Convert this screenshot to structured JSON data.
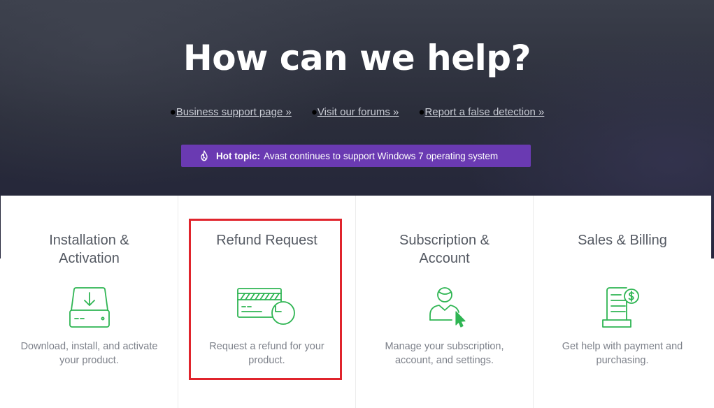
{
  "hero": {
    "title": "How can we help?",
    "links": [
      {
        "label": "Business support page »"
      },
      {
        "label": "Visit our forums »"
      },
      {
        "label": "Report a false detection »"
      }
    ],
    "hot_topic": {
      "label": "Hot topic:",
      "text": "Avast continues to support Windows 7 operating system",
      "icon": "flame-icon"
    }
  },
  "cards": [
    {
      "title": "Installation & Activation",
      "icon": "drive-download-icon",
      "description": "Download, install, and activate your product."
    },
    {
      "title": "Refund Request",
      "icon": "credit-card-refund-icon",
      "description": "Request a refund for your product."
    },
    {
      "title": "Subscription & Account",
      "icon": "user-account-icon",
      "description": "Manage your subscription, account, and settings."
    },
    {
      "title": "Sales & Billing",
      "icon": "invoice-dollar-icon",
      "description": "Get help with payment and purchasing."
    }
  ],
  "colors": {
    "accent_green": "#2fb553",
    "hot_topic_purple": "#6a3ab2",
    "highlight_red": "#e0242c"
  }
}
